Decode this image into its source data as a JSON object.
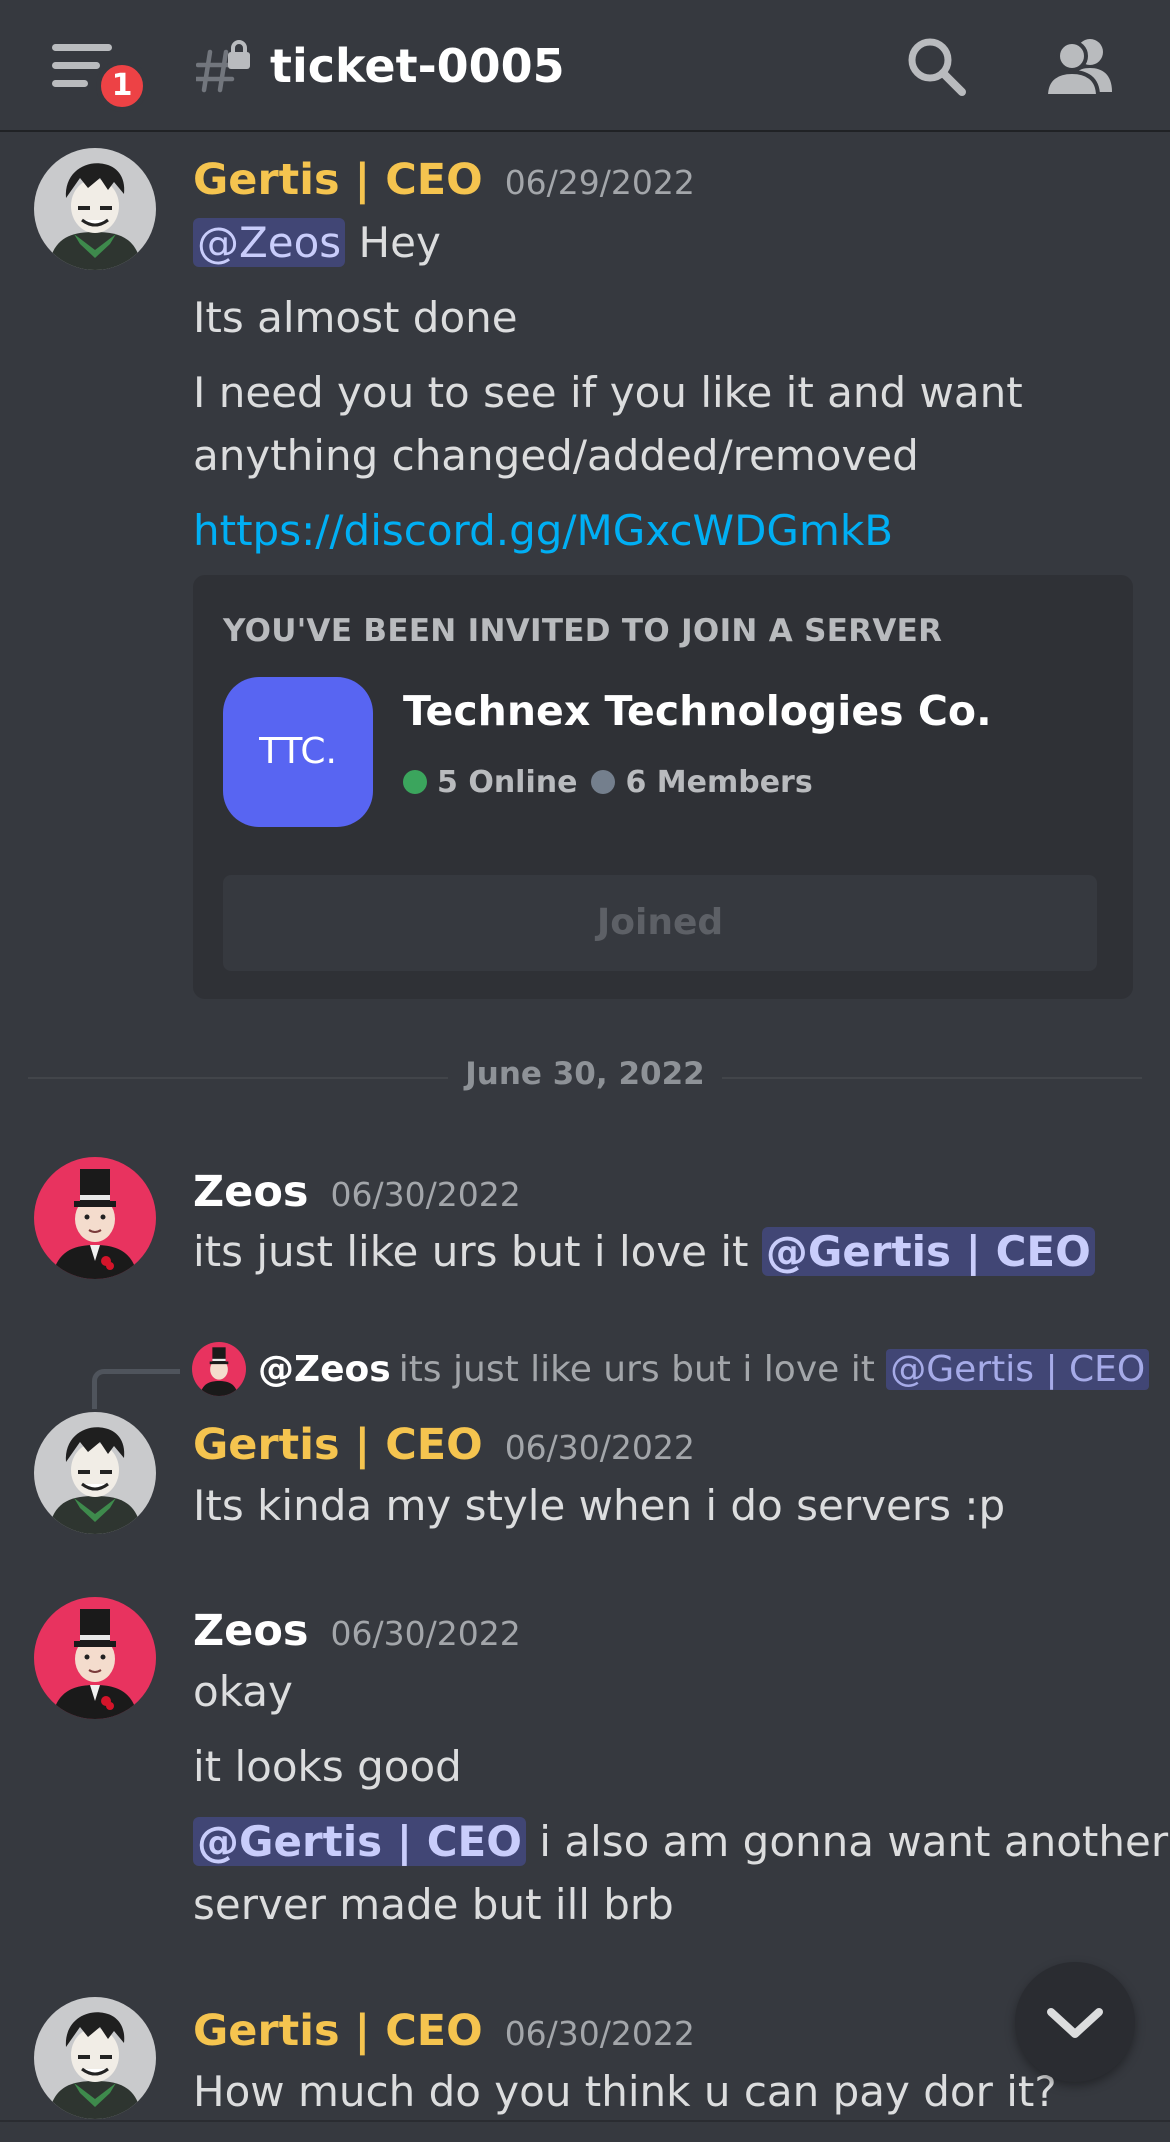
{
  "header": {
    "notification_count": "1",
    "channel_name": "ticket-0005"
  },
  "messages": [
    {
      "author": "Gertis | CEO",
      "timestamp": "06/29/2022",
      "lines": {
        "l1_mention": "@Zeos",
        "l1_text": " Hey",
        "l2": "Its almost done",
        "l3": "I need you to see if you like it and want",
        "l4": "anything changed/added/removed",
        "l5_link": "https://discord.gg/MGxcWDGmkB"
      },
      "invite": {
        "heading": "YOU'VE BEEN INVITED TO JOIN A SERVER",
        "server_icon_text": "TTC.",
        "server_name": "Technex Technologies Co.",
        "online": "5 Online",
        "members": "6 Members",
        "button": "Joined"
      }
    },
    {
      "author": "Zeos",
      "timestamp": "06/30/2022",
      "text": "its just like urs but i love it ",
      "mention": "@Gertis | CEO"
    },
    {
      "reply_to": {
        "author": "@Zeos",
        "text": "its just like urs but i love it ",
        "mention": "@Gertis | CEO"
      },
      "author": "Gertis | CEO",
      "timestamp": "06/30/2022",
      "text": "Its kinda my style when i do servers :p"
    },
    {
      "author": "Zeos",
      "timestamp": "06/30/2022",
      "l1": "okay",
      "l2": "it looks good",
      "l3_mention": "@Gertis | CEO",
      "l3_text": " i also am gonna want another",
      "l4": "server made but ill brb"
    },
    {
      "author": "Gertis | CEO",
      "timestamp": "06/30/2022",
      "text": "How much do you think u can pay dor it?"
    }
  ],
  "date_divider": "June 30, 2022",
  "colors": {
    "background": "#36393f",
    "gertis_name": "#f5c44f",
    "link": "#00aff4",
    "mention_bg": "#414675",
    "server_icon": "#5865f2",
    "online_dot": "#3ba55d",
    "badge": "#ed4245"
  },
  "icons": [
    "hamburger-menu-icon",
    "locked-channel-icon",
    "search-icon",
    "members-icon",
    "chevron-down-icon"
  ]
}
